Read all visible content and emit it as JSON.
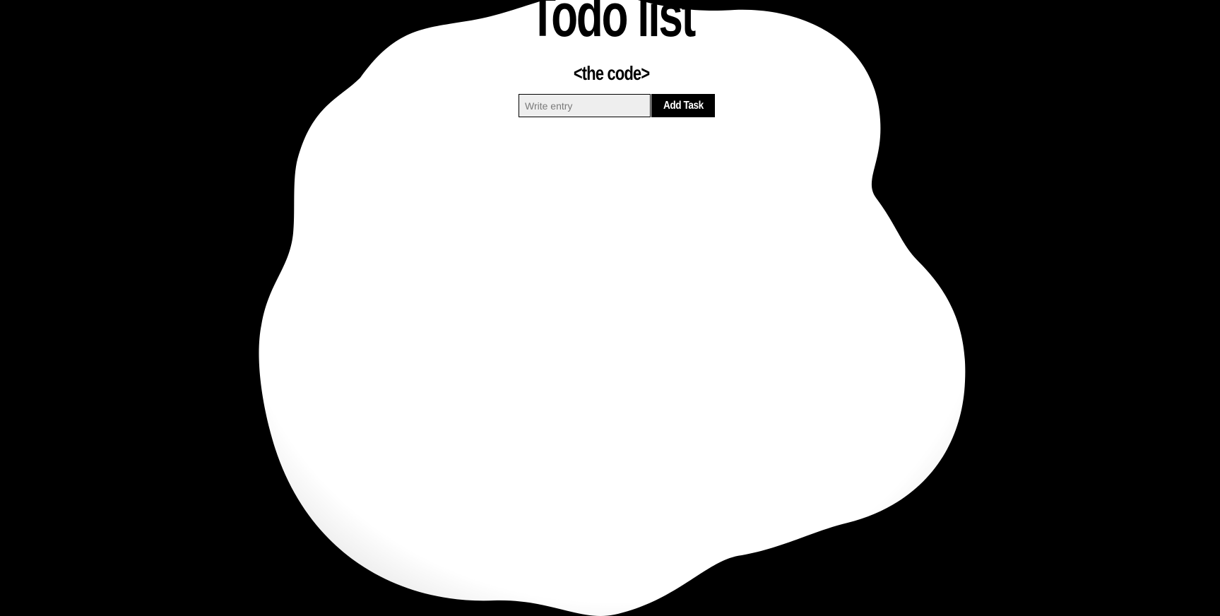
{
  "page": {
    "title": "Todo list",
    "subtitle": "<the code>"
  },
  "form": {
    "input_value": "",
    "input_placeholder": "Write entry",
    "add_label": "Add Task"
  },
  "tasks": [],
  "colors": {
    "background": "#000000",
    "blob": "#ffffff",
    "input_bg": "#eeeeee",
    "button_bg": "#000000",
    "button_text": "#ffffff"
  }
}
